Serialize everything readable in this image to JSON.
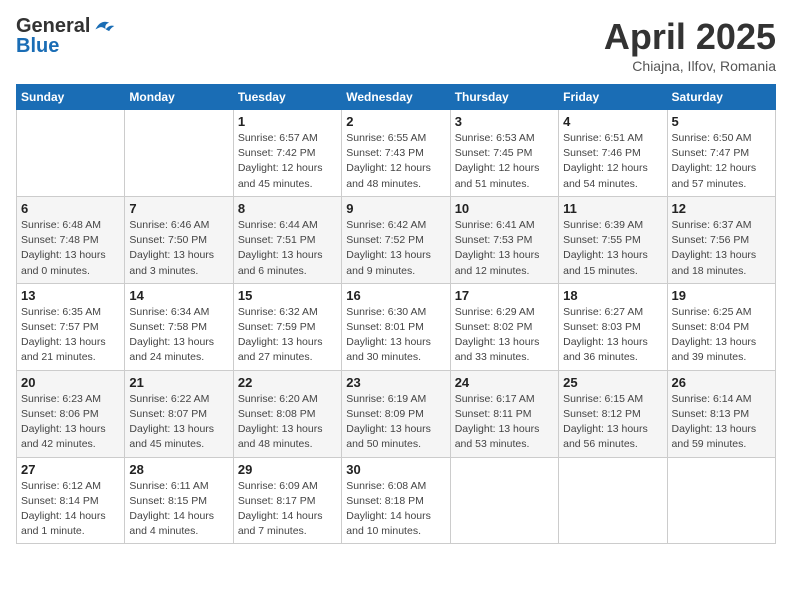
{
  "header": {
    "logo_general": "General",
    "logo_blue": "Blue",
    "month_title": "April 2025",
    "subtitle": "Chiajna, Ilfov, Romania"
  },
  "weekdays": [
    "Sunday",
    "Monday",
    "Tuesday",
    "Wednesday",
    "Thursday",
    "Friday",
    "Saturday"
  ],
  "weeks": [
    [
      {
        "day": "",
        "detail": ""
      },
      {
        "day": "",
        "detail": ""
      },
      {
        "day": "1",
        "detail": "Sunrise: 6:57 AM\nSunset: 7:42 PM\nDaylight: 12 hours\nand 45 minutes."
      },
      {
        "day": "2",
        "detail": "Sunrise: 6:55 AM\nSunset: 7:43 PM\nDaylight: 12 hours\nand 48 minutes."
      },
      {
        "day": "3",
        "detail": "Sunrise: 6:53 AM\nSunset: 7:45 PM\nDaylight: 12 hours\nand 51 minutes."
      },
      {
        "day": "4",
        "detail": "Sunrise: 6:51 AM\nSunset: 7:46 PM\nDaylight: 12 hours\nand 54 minutes."
      },
      {
        "day": "5",
        "detail": "Sunrise: 6:50 AM\nSunset: 7:47 PM\nDaylight: 12 hours\nand 57 minutes."
      }
    ],
    [
      {
        "day": "6",
        "detail": "Sunrise: 6:48 AM\nSunset: 7:48 PM\nDaylight: 13 hours\nand 0 minutes."
      },
      {
        "day": "7",
        "detail": "Sunrise: 6:46 AM\nSunset: 7:50 PM\nDaylight: 13 hours\nand 3 minutes."
      },
      {
        "day": "8",
        "detail": "Sunrise: 6:44 AM\nSunset: 7:51 PM\nDaylight: 13 hours\nand 6 minutes."
      },
      {
        "day": "9",
        "detail": "Sunrise: 6:42 AM\nSunset: 7:52 PM\nDaylight: 13 hours\nand 9 minutes."
      },
      {
        "day": "10",
        "detail": "Sunrise: 6:41 AM\nSunset: 7:53 PM\nDaylight: 13 hours\nand 12 minutes."
      },
      {
        "day": "11",
        "detail": "Sunrise: 6:39 AM\nSunset: 7:55 PM\nDaylight: 13 hours\nand 15 minutes."
      },
      {
        "day": "12",
        "detail": "Sunrise: 6:37 AM\nSunset: 7:56 PM\nDaylight: 13 hours\nand 18 minutes."
      }
    ],
    [
      {
        "day": "13",
        "detail": "Sunrise: 6:35 AM\nSunset: 7:57 PM\nDaylight: 13 hours\nand 21 minutes."
      },
      {
        "day": "14",
        "detail": "Sunrise: 6:34 AM\nSunset: 7:58 PM\nDaylight: 13 hours\nand 24 minutes."
      },
      {
        "day": "15",
        "detail": "Sunrise: 6:32 AM\nSunset: 7:59 PM\nDaylight: 13 hours\nand 27 minutes."
      },
      {
        "day": "16",
        "detail": "Sunrise: 6:30 AM\nSunset: 8:01 PM\nDaylight: 13 hours\nand 30 minutes."
      },
      {
        "day": "17",
        "detail": "Sunrise: 6:29 AM\nSunset: 8:02 PM\nDaylight: 13 hours\nand 33 minutes."
      },
      {
        "day": "18",
        "detail": "Sunrise: 6:27 AM\nSunset: 8:03 PM\nDaylight: 13 hours\nand 36 minutes."
      },
      {
        "day": "19",
        "detail": "Sunrise: 6:25 AM\nSunset: 8:04 PM\nDaylight: 13 hours\nand 39 minutes."
      }
    ],
    [
      {
        "day": "20",
        "detail": "Sunrise: 6:23 AM\nSunset: 8:06 PM\nDaylight: 13 hours\nand 42 minutes."
      },
      {
        "day": "21",
        "detail": "Sunrise: 6:22 AM\nSunset: 8:07 PM\nDaylight: 13 hours\nand 45 minutes."
      },
      {
        "day": "22",
        "detail": "Sunrise: 6:20 AM\nSunset: 8:08 PM\nDaylight: 13 hours\nand 48 minutes."
      },
      {
        "day": "23",
        "detail": "Sunrise: 6:19 AM\nSunset: 8:09 PM\nDaylight: 13 hours\nand 50 minutes."
      },
      {
        "day": "24",
        "detail": "Sunrise: 6:17 AM\nSunset: 8:11 PM\nDaylight: 13 hours\nand 53 minutes."
      },
      {
        "day": "25",
        "detail": "Sunrise: 6:15 AM\nSunset: 8:12 PM\nDaylight: 13 hours\nand 56 minutes."
      },
      {
        "day": "26",
        "detail": "Sunrise: 6:14 AM\nSunset: 8:13 PM\nDaylight: 13 hours\nand 59 minutes."
      }
    ],
    [
      {
        "day": "27",
        "detail": "Sunrise: 6:12 AM\nSunset: 8:14 PM\nDaylight: 14 hours\nand 1 minute."
      },
      {
        "day": "28",
        "detail": "Sunrise: 6:11 AM\nSunset: 8:15 PM\nDaylight: 14 hours\nand 4 minutes."
      },
      {
        "day": "29",
        "detail": "Sunrise: 6:09 AM\nSunset: 8:17 PM\nDaylight: 14 hours\nand 7 minutes."
      },
      {
        "day": "30",
        "detail": "Sunrise: 6:08 AM\nSunset: 8:18 PM\nDaylight: 14 hours\nand 10 minutes."
      },
      {
        "day": "",
        "detail": ""
      },
      {
        "day": "",
        "detail": ""
      },
      {
        "day": "",
        "detail": ""
      }
    ]
  ]
}
